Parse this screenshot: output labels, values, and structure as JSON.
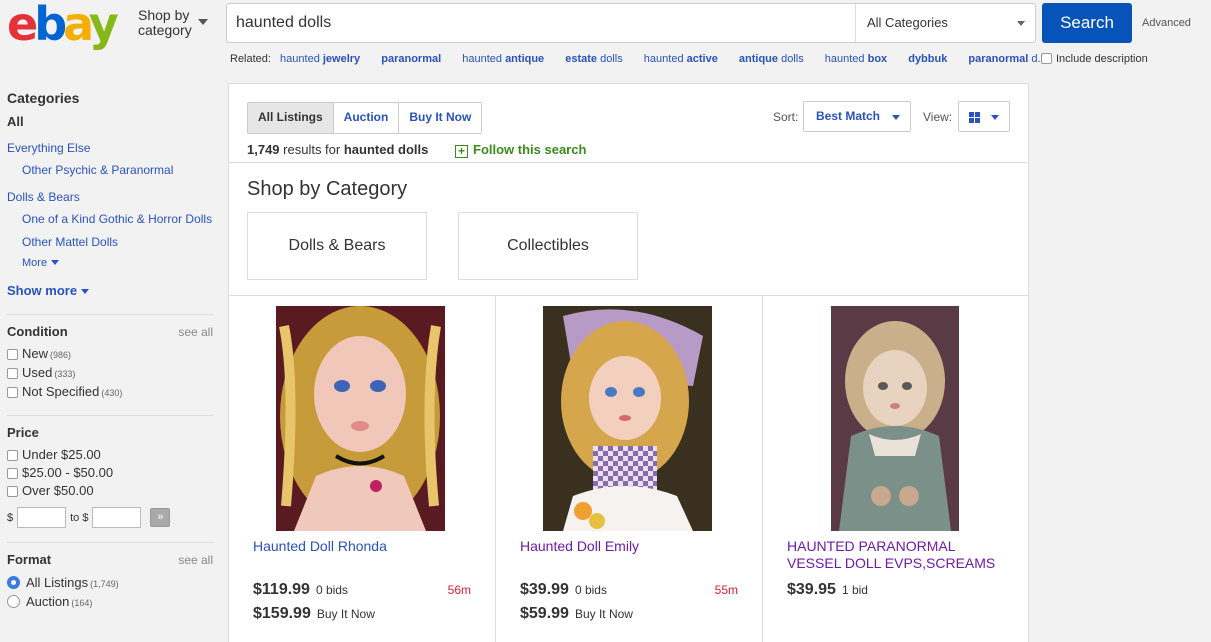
{
  "header": {
    "logo_letters": [
      "e",
      "b",
      "a",
      "y"
    ],
    "shop_by_line1": "Shop by",
    "shop_by_line2": "category",
    "search_value": "haunted dolls",
    "category_select": "All Categories",
    "search_button": "Search",
    "advanced_link": "Advanced",
    "include_description": "Include description",
    "related_label": "Related:",
    "related": [
      {
        "pre": "haunted ",
        "bold": "jewelry",
        "post": ""
      },
      {
        "pre": "",
        "bold": "paranormal",
        "post": ""
      },
      {
        "pre": "haunted ",
        "bold": "antique",
        "post": ""
      },
      {
        "pre": "",
        "bold": "estate",
        "post": " dolls"
      },
      {
        "pre": "haunted ",
        "bold": "active",
        "post": ""
      },
      {
        "pre": "",
        "bold": "antique",
        "post": " dolls"
      },
      {
        "pre": "haunted ",
        "bold": "box",
        "post": ""
      },
      {
        "pre": "",
        "bold": "dybbuk",
        "post": ""
      },
      {
        "pre": "",
        "bold": "paranormal",
        "post": " d..."
      }
    ]
  },
  "sidebar": {
    "categories_title": "Categories",
    "all_label": "All",
    "cat_everything_else": "Everything Else",
    "cat_other_psychic": "Other Psychic & Paranormal",
    "cat_dolls_bears": "Dolls & Bears",
    "cat_gothic_horror": "One of a Kind Gothic & Horror Dolls",
    "cat_other_mattel": "Other Mattel Dolls",
    "more_label": "More",
    "show_more": "Show more",
    "condition_title": "Condition",
    "see_all": "see all",
    "condition_options": [
      {
        "label": "New",
        "count": "(986)"
      },
      {
        "label": "Used",
        "count": "(333)"
      },
      {
        "label": "Not Specified",
        "count": "(430)"
      }
    ],
    "price_title": "Price",
    "price_options": [
      "Under $25.00",
      "$25.00 - $50.00",
      "Over $50.00"
    ],
    "price_dollar": "$",
    "price_to": "to $",
    "price_go": "»",
    "format_title": "Format",
    "format_options": [
      {
        "label": "All Listings",
        "count": "(1,749)",
        "selected": true
      },
      {
        "label": "Auction",
        "count": "(164)",
        "selected": false
      }
    ]
  },
  "results": {
    "tabs": [
      "All Listings",
      "Auction",
      "Buy It Now"
    ],
    "sort_label": "Sort:",
    "sort_value": "Best Match",
    "view_label": "View:",
    "count_number": "1,749",
    "count_middle": " results for ",
    "count_query": "haunted dolls",
    "follow_label": "Follow this search",
    "shop_by_category_title": "Shop by Category",
    "category_cards": [
      "Dolls & Bears",
      "Collectibles"
    ]
  },
  "items": [
    {
      "title": "Haunted Doll Rhonda",
      "title_color": "blue",
      "price1": "$119.99",
      "price1_sub": "0 bids",
      "time_left": "56m",
      "price2": "$159.99",
      "price2_sub": "Buy It Now"
    },
    {
      "title": "Haunted Doll Emily",
      "title_color": "purple",
      "price1": "$39.99",
      "price1_sub": "0 bids",
      "time_left": "55m",
      "price2": "$59.99",
      "price2_sub": "Buy It Now"
    },
    {
      "title": "HAUNTED PARANORMAL VESSEL DOLL EVPS,SCREAMS",
      "title_color": "purple",
      "price1": "$39.95",
      "price1_sub": "1 bid",
      "time_left": "",
      "price2": "",
      "price2_sub": ""
    }
  ],
  "colors": {
    "ebay_red": "#e53238",
    "ebay_blue": "#0064d2",
    "ebay_yellow": "#f5af02",
    "ebay_green": "#86b817",
    "link_blue": "#2a52be",
    "visited_purple": "#6f1aa6",
    "search_button": "#0654ba",
    "follow_green": "#3b8a1e",
    "time_red": "#dd1e31"
  }
}
